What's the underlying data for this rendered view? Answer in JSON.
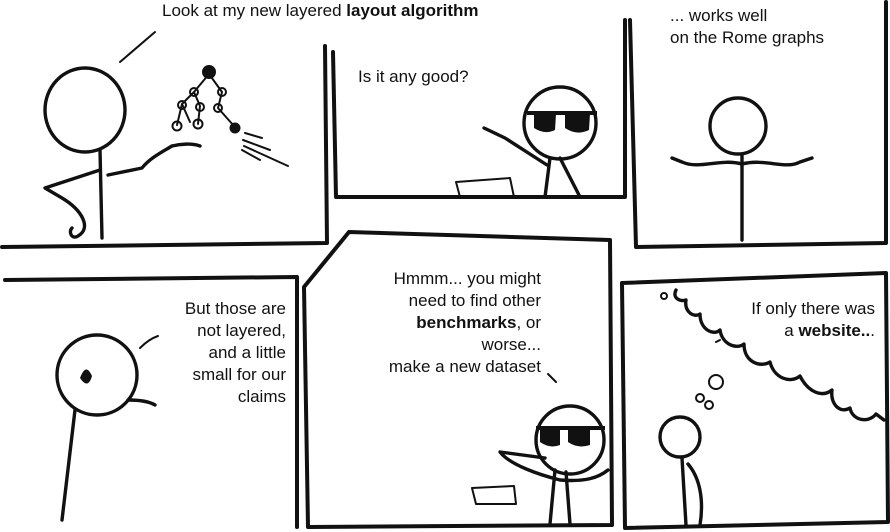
{
  "panels": [
    {
      "id": 1,
      "caption_pre": "Look at my  new layered ",
      "caption_bold": "layout algorithm"
    },
    {
      "id": 2,
      "caption": "Is it any good?"
    },
    {
      "id": 3,
      "caption_lines": [
        "... works well",
        "on the Rome graphs"
      ]
    },
    {
      "id": 4,
      "caption_lines": [
        "But those are",
        "not layered,",
        "and a little",
        "small for our",
        "claims"
      ]
    },
    {
      "id": 5,
      "line1": "Hmmm... you might",
      "line2": "need to find other",
      "line3_bold": "benchmarks",
      "line3_rest": ", or",
      "line4": "worse...",
      "line5": "make a new dataset"
    },
    {
      "id": 6,
      "line1": "If only there was",
      "line2_pre": "a ",
      "line2_bold": "website..",
      "line2_post": "."
    }
  ]
}
